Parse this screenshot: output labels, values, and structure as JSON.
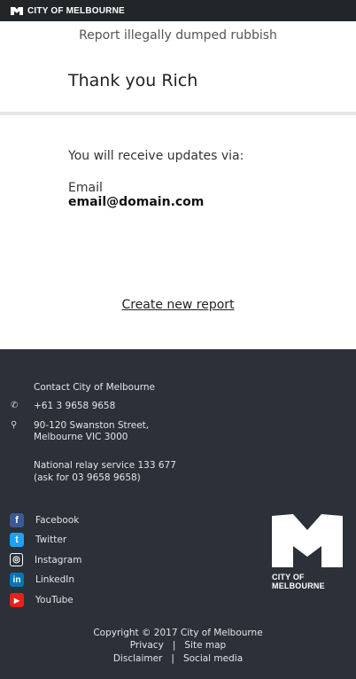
{
  "topbar": {
    "brand": "CITY OF MELBOURNE"
  },
  "page": {
    "subtitle": "Report illegally dumped rubbish",
    "thanks": "Thank you Rich"
  },
  "updates": {
    "intro": "You will receive updates via:",
    "method_label": "Email",
    "method_value": "email@domain.com"
  },
  "actions": {
    "create_new": "Create new report"
  },
  "footer": {
    "heading": "Contact City of Melbourne",
    "phone": "+61 3 9658 9658",
    "address_line1": "90-120 Swanston Street,",
    "address_line2": "Melbourne VIC 3000",
    "relay_line1": "National relay service 133 677",
    "relay_line2": "(ask for 03 9658 9658)",
    "social": [
      {
        "label": "Facebook",
        "icon": "facebook-icon",
        "color": "#3b5998",
        "glyph": "f"
      },
      {
        "label": "Twitter",
        "icon": "twitter-icon",
        "color": "#1da1f2",
        "glyph": "t"
      },
      {
        "label": "Instagram",
        "icon": "instagram-icon",
        "color": "#2b3039",
        "glyph": "◎"
      },
      {
        "label": "LinkedIn",
        "icon": "linkedin-icon",
        "color": "#0077b5",
        "glyph": "in"
      },
      {
        "label": "YouTube",
        "icon": "youtube-icon",
        "color": "#e62117",
        "glyph": "▶"
      }
    ],
    "logo_text": "CITY OF MELBOURNE",
    "copyright": "Copyright © 2017 City of Melbourne",
    "privacy": "Privacy",
    "sitemap": "Site map",
    "disclaimer": "Disclaimer",
    "social_media": "Social media",
    "separator": "|"
  },
  "colors": {
    "topbar": "#232629",
    "footer": "#2b3039"
  }
}
